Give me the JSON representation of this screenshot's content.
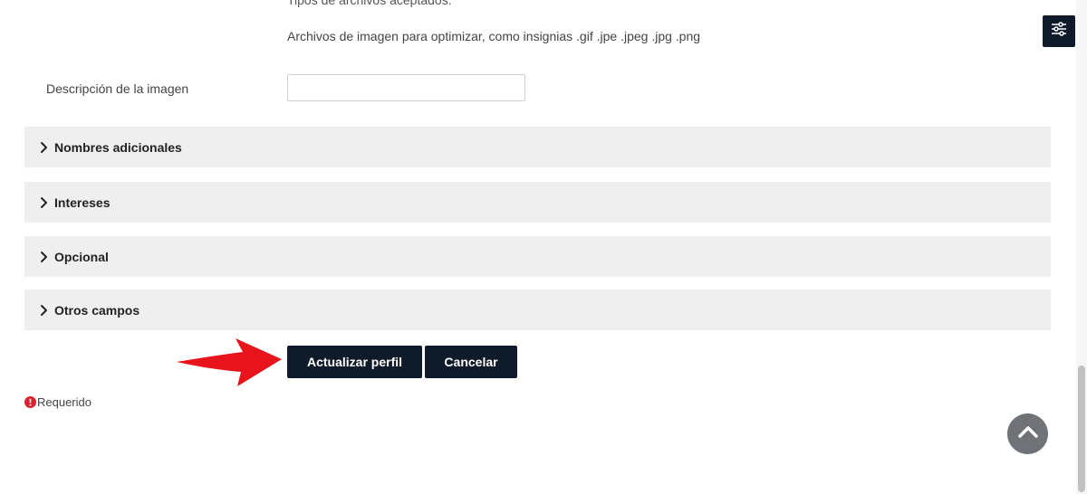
{
  "image_field": {
    "accepted_label": "Tipos de archivos aceptados:",
    "accepted_types": "Archivos de imagen para optimizar, como insignias .gif .jpe .jpeg .jpg .png"
  },
  "image_description": {
    "label": "Descripción de la imagen",
    "value": ""
  },
  "sections": [
    {
      "title": "Nombres adicionales",
      "icon": "chevron-right-icon"
    },
    {
      "title": "Intereses",
      "icon": "chevron-right-icon"
    },
    {
      "title": "Opcional",
      "icon": "chevron-right-icon"
    },
    {
      "title": "Otros campos",
      "icon": "chevron-right-icon"
    }
  ],
  "buttons": {
    "update": "Actualizar perfil",
    "cancel": "Cancelar"
  },
  "required_note": "Requerido",
  "icons": {
    "settings": "sliders-icon",
    "scroll_top": "chevron-up-icon",
    "required": "exclamation-circle-icon",
    "annotation": "red-arrow-icon"
  },
  "colors": {
    "primary_button": "#0f1a2b",
    "section_bg": "#efefef",
    "required_icon": "#d9232d",
    "annotation_arrow": "#e8141b",
    "scroll_top_bg": "#6f7378"
  }
}
